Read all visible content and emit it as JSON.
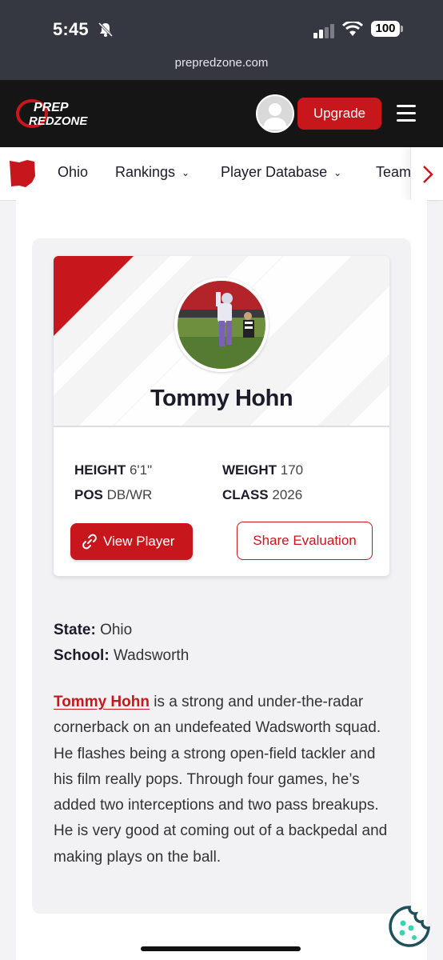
{
  "status_bar": {
    "time": "5:45",
    "battery": "100"
  },
  "browser": {
    "url": "prepredzone.com"
  },
  "header": {
    "logo_top": "PREP",
    "logo_bottom": "REDZONE",
    "upgrade_label": "Upgrade"
  },
  "nav": {
    "items": [
      {
        "label": "Ohio"
      },
      {
        "label": "Rankings"
      },
      {
        "label": "Player Database"
      },
      {
        "label": "Team"
      }
    ],
    "caret": "⌄",
    "next_arrow": "›"
  },
  "player": {
    "name": "Tommy Hohn",
    "stats": {
      "height_label": "HEIGHT",
      "height_value": "6'1\"",
      "weight_label": "WEIGHT",
      "weight_value": "170",
      "pos_label": "POS",
      "pos_value": "DB/WR",
      "class_label": "CLASS",
      "class_value": "2026"
    },
    "view_button": "View Player",
    "share_button": "Share Evaluation"
  },
  "details": {
    "state_label": "State:",
    "state_value": "Ohio",
    "school_label": "School:",
    "school_value": "Wadsworth"
  },
  "bio": {
    "link_text": "Tommy Hohn",
    "text": " is a strong and under-the-radar cornerback on an undefeated Wadsworth squad. He flashes being a strong open-field tackler and his film really pops. Through four games, he’s added two interceptions and two pass breakups. He is very good at coming out of a backpedal and making plays on the ball."
  },
  "colors": {
    "brand_red": "#c8161d",
    "header_bg": "#151515",
    "status_bg": "#353840"
  }
}
